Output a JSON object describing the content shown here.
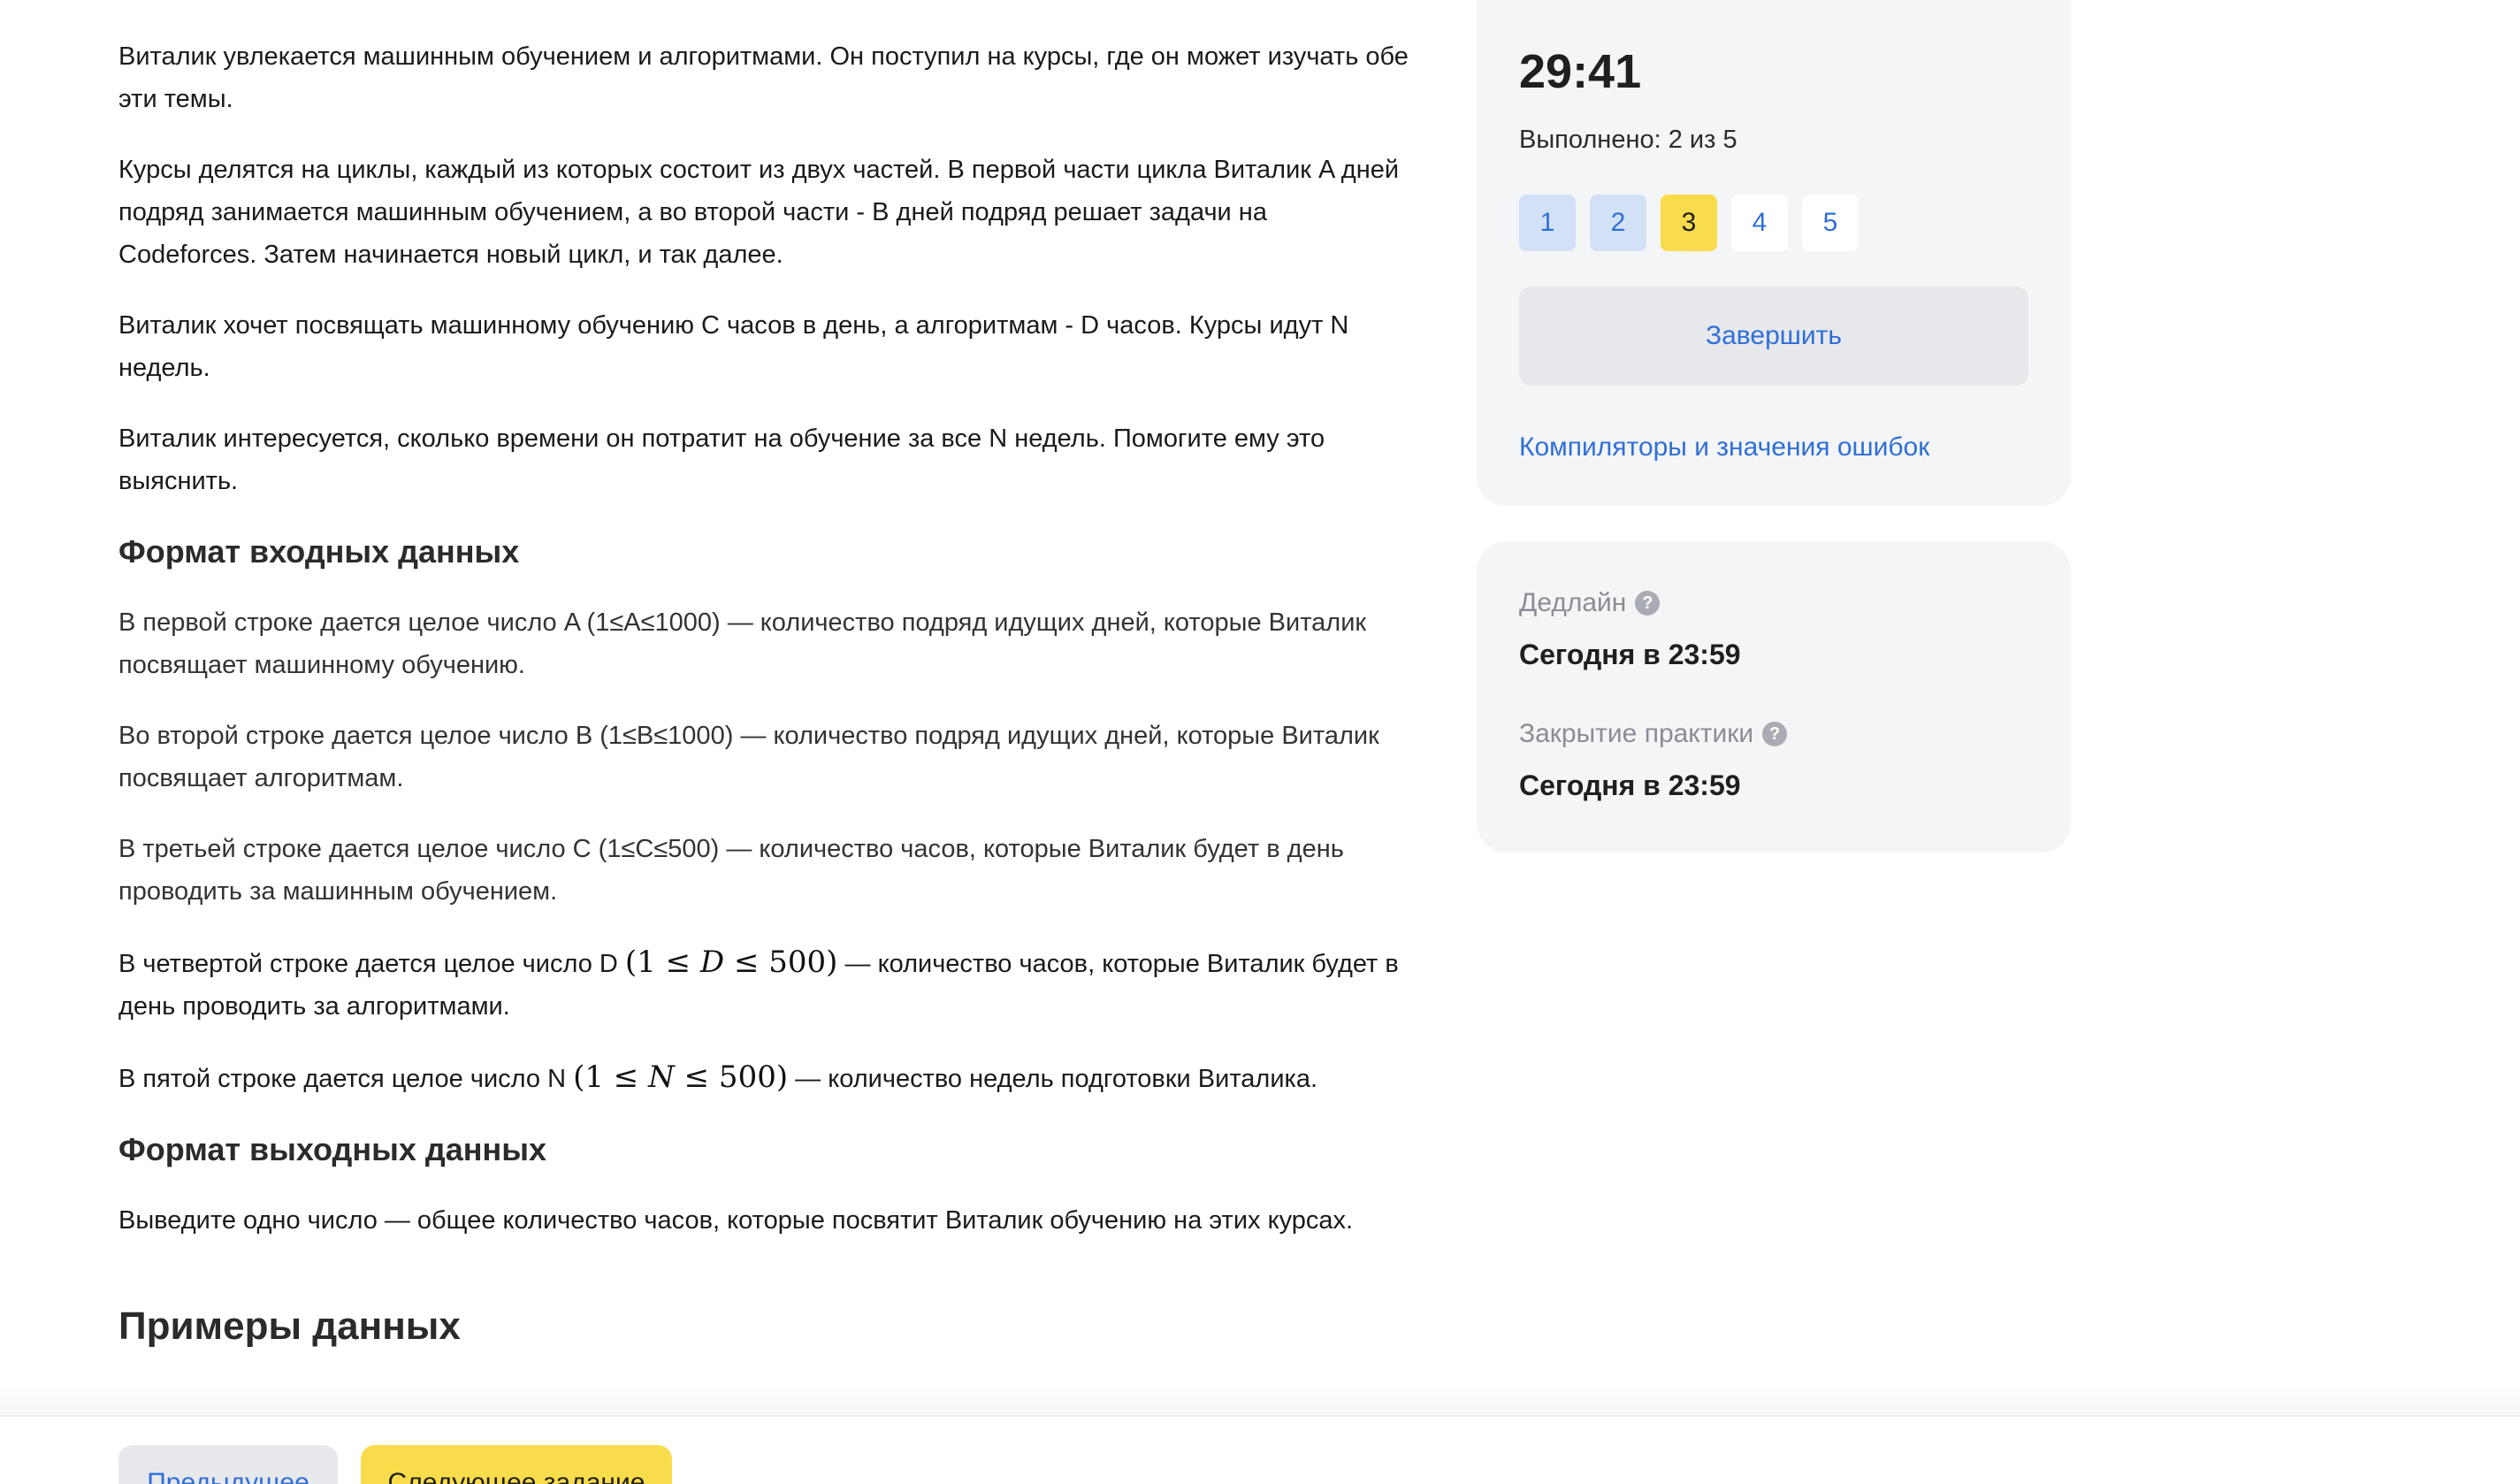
{
  "statement": {
    "paragraphs": [
      "Виталик увлекается машинным обучением и алгоритмами. Он поступил на курсы, где он может изучать обе эти темы.",
      "Курсы делятся на циклы, каждый из которых состоит из двух частей. В первой части цикла Виталик A дней подряд занимается машинным обучением, а во второй части - B дней подряд решает задачи на Codeforces. Затем начинается новый цикл, и так далее.",
      "Виталик хочет посвящать машинному обучению C часов в день, а алгоритмам - D часов. Курсы идут N недель.",
      "Виталик интересуется, сколько времени он потратит на обучение за все N недель. Помогите ему это выяснить."
    ]
  },
  "input_format": {
    "title": "Формат входных данных",
    "line_a": "В первой строке дается целое число A (1≤A≤1000) — количество подряд идущих дней, которые Виталик посвящает машинному обучению.",
    "line_b": "Во второй строке дается целое число B (1≤B≤1000) — количество подряд идущих дней, которые Виталик посвящает алгоритмам.",
    "line_c": "В третьей строке дается целое число C (1≤C≤500) — количество часов, которые Виталик будет в день проводить за машинным обучением.",
    "line_d": {
      "before": "В четвертой строке дается целое число D ",
      "math_open": "(1 ≤ ",
      "math_var": "D",
      "math_close": " ≤ 500)",
      "after": " — количество часов, которые Виталик будет в день проводить за алгоритмами."
    },
    "line_n": {
      "before": "В пятой строке дается целое число N ",
      "math_open": "(1 ≤ ",
      "math_var": "N",
      "math_close": " ≤ 500)",
      "after": " — количество недель подготовки Виталика."
    }
  },
  "output_format": {
    "title": "Формат выходных данных",
    "text": "Выведите одно число — общее количество часов, которые посвятит Виталик обучению на этих курсах."
  },
  "examples": {
    "title": "Примеры данных"
  },
  "sidebar": {
    "timer": "29:41",
    "done_label": "Выполнено: 2 из 5",
    "tasks": [
      "1",
      "2",
      "3",
      "4",
      "5"
    ],
    "finish_label": "Завершить",
    "compilers_link": "Компиляторы и значения ошибок",
    "deadline_label": "Дедлайн",
    "deadline_value": "Сегодня в 23:59",
    "closing_label": "Закрытие практики",
    "closing_value": "Сегодня в 23:59",
    "help_icon_glyph": "?"
  },
  "footer": {
    "prev_label": "Предыдущее",
    "next_label": "Следующее задание"
  },
  "colors": {
    "accent_link": "#2f6fd6",
    "accent_yellow": "#f8dc4b",
    "solved_task": "#d3e1f7",
    "panel_bg": "#f4f5f7"
  },
  "icons": {
    "help": "question-circle-icon"
  }
}
